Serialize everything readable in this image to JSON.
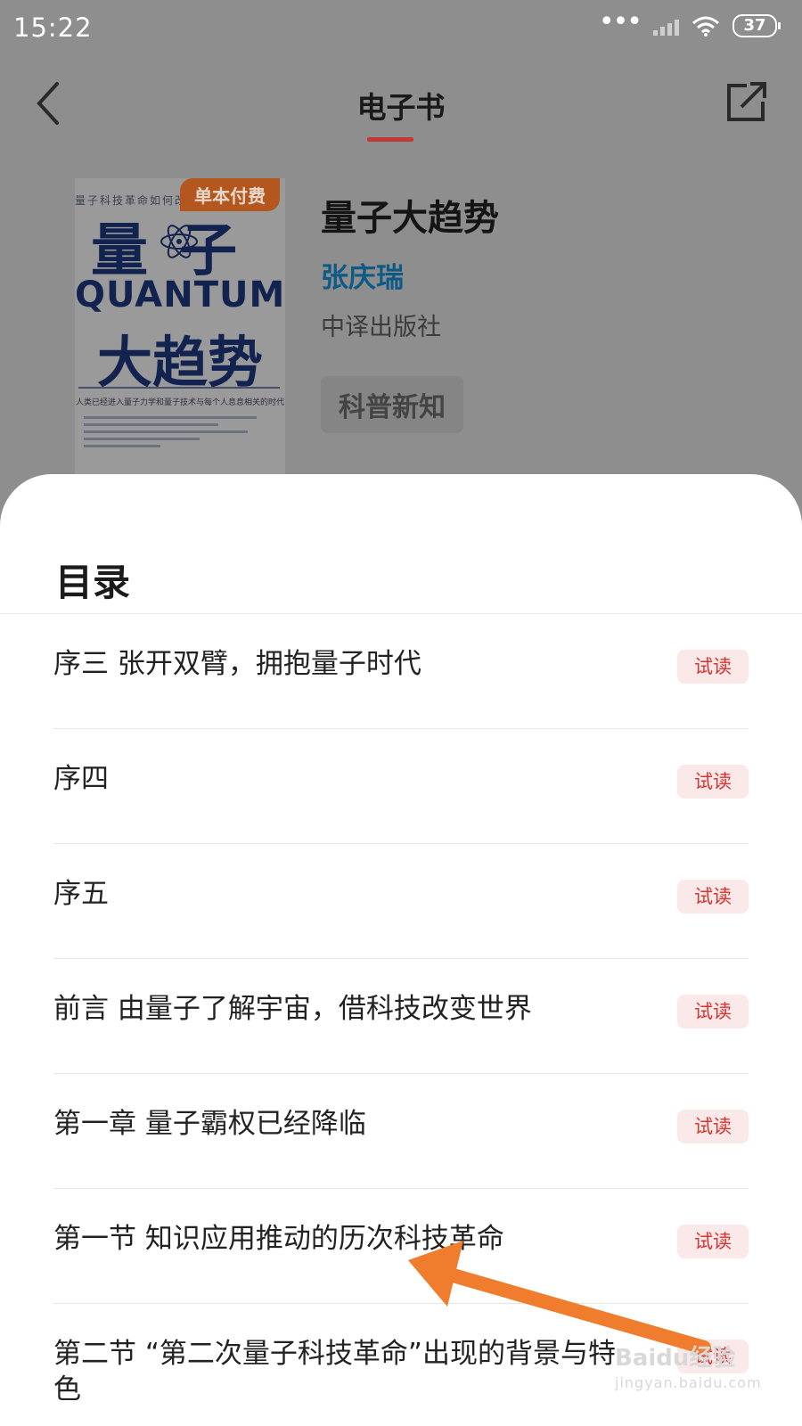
{
  "status_bar": {
    "time": "15:22",
    "battery": "37"
  },
  "nav": {
    "title": "电子书"
  },
  "book": {
    "cover": {
      "top_text": "量子科技革命如何改",
      "badge": "单本付费",
      "title_line1": "量子",
      "title_en": "QUANTUM",
      "title_line2": "大趋势",
      "subtitle": "人类已经进入量子力学和量子技术与每个人息息相关的时代"
    },
    "title": "量子大趋势",
    "author": "张庆瑞",
    "publisher": "中译出版社",
    "tag": "科普新知"
  },
  "toc": {
    "heading": "目录",
    "trial_label": "试读",
    "items": [
      {
        "label": "序三 张开双臂，拥抱量子时代"
      },
      {
        "label": "序四"
      },
      {
        "label": "序五"
      },
      {
        "label": "前言 由量子了解宇宙，借科技改变世界"
      },
      {
        "label": "第一章 量子霸权已经降临"
      },
      {
        "label": "第一节 知识应用推动的历次科技革命"
      },
      {
        "label": "第二节 “第二次量子科技革命”出现的背景与特色"
      }
    ]
  },
  "watermark": {
    "brand": "Baidu经验",
    "url": "jingyan.baidu.com"
  },
  "colors": {
    "accent": "#d8342f",
    "author": "#0e5a86",
    "arrow": "#f07d2e"
  }
}
